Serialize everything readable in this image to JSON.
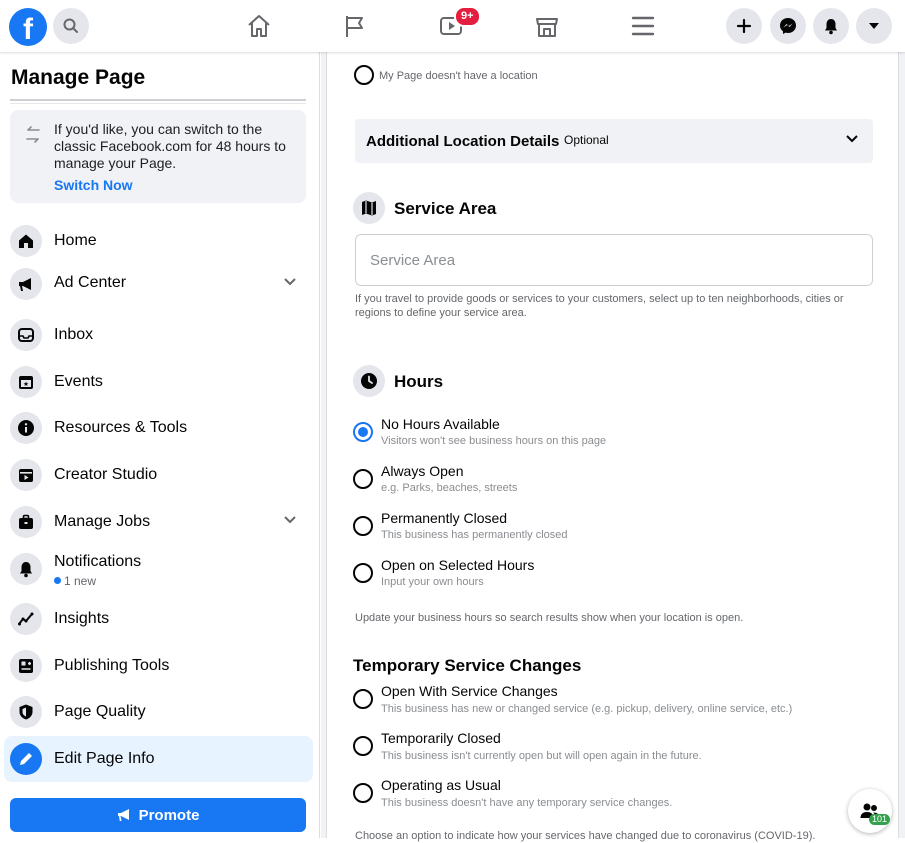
{
  "topbar": {
    "logo_letter": "f",
    "video_badge": "9+",
    "icons": [
      "search-icon",
      "home-icon",
      "flag-icon",
      "watch-icon",
      "marketplace-icon",
      "menu-icon",
      "plus-icon",
      "messenger-icon",
      "bell-icon",
      "caret-icon"
    ]
  },
  "sidebar": {
    "title": "Manage Page",
    "switch_notice": "If you'd like, you can switch to the classic Facebook.com for 48 hours to manage your Page.",
    "switch_link": "Switch Now",
    "items": [
      {
        "label": "Home",
        "icon": "home-icon"
      },
      {
        "label": "Ad Center",
        "icon": "megaphone-icon"
      },
      {
        "label": "Inbox",
        "icon": "inbox-icon"
      },
      {
        "label": "Events",
        "icon": "calendar-icon"
      },
      {
        "label": "Resources & Tools",
        "icon": "info-icon"
      },
      {
        "label": "Creator Studio",
        "icon": "clapper-icon"
      },
      {
        "label": "Manage Jobs",
        "icon": "briefcase-icon"
      },
      {
        "label": "Notifications",
        "icon": "bell-icon",
        "sub": "1 new"
      },
      {
        "label": "Insights",
        "icon": "chart-icon"
      },
      {
        "label": "Publishing Tools",
        "icon": "publishing-icon"
      },
      {
        "label": "Page Quality",
        "icon": "shield-icon"
      },
      {
        "label": "Edit Page Info",
        "icon": "pencil-icon"
      }
    ],
    "promote": "Promote"
  },
  "main": {
    "no_location": "My Page doesn't have a location",
    "additional": {
      "title": "Additional Location Details",
      "tag": "Optional"
    },
    "service_area": {
      "title": "Service Area",
      "placeholder": "Service Area",
      "helper": "If you travel to provide goods or services to your customers, select up to ten neighborhoods, cities or regions to define your service area."
    },
    "hours": {
      "title": "Hours",
      "options": [
        {
          "title": "No Hours Available",
          "sub": "Visitors won't see business hours on this page",
          "selected": true
        },
        {
          "title": "Always Open",
          "sub": "e.g. Parks, beaches, streets",
          "selected": false
        },
        {
          "title": "Permanently Closed",
          "sub": "This business has permanently closed",
          "selected": false
        },
        {
          "title": "Open on Selected Hours",
          "sub": "Input your own hours",
          "selected": false
        }
      ],
      "helper": "Update your business hours so search results show when your location is open."
    },
    "temporary": {
      "title": "Temporary Service Changes",
      "options": [
        {
          "title": "Open With Service Changes",
          "sub": "This business has new or changed service (e.g. pickup, delivery, online service, etc.)"
        },
        {
          "title": "Temporarily Closed",
          "sub": "This business isn't currently open but will open again in the future."
        },
        {
          "title": "Operating as Usual",
          "sub": "This business doesn't have any temporary service changes."
        }
      ],
      "helper": "Choose an option to indicate how your services have changed due to coronavirus (COVID-19)."
    }
  },
  "float": {
    "badge": "101"
  },
  "colors": {
    "accent": "#1877f2",
    "badge_red": "#e41e3f",
    "online_green": "#31a24c"
  }
}
